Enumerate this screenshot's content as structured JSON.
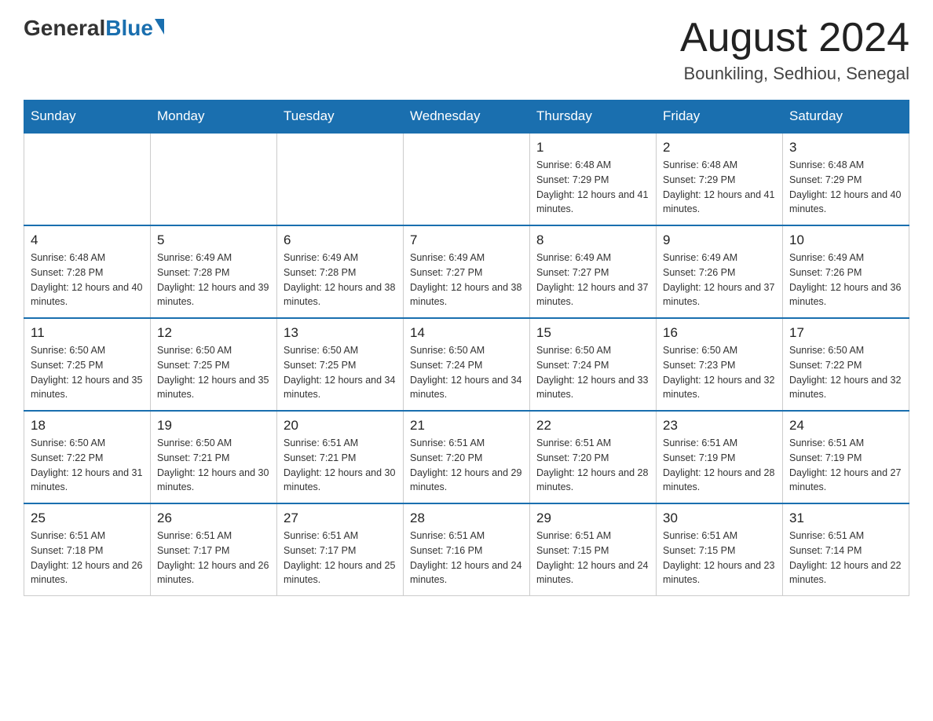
{
  "header": {
    "logo": {
      "general": "General",
      "blue": "Blue"
    },
    "title": "August 2024",
    "location": "Bounkiling, Sedhiou, Senegal"
  },
  "calendar": {
    "days_of_week": [
      "Sunday",
      "Monday",
      "Tuesday",
      "Wednesday",
      "Thursday",
      "Friday",
      "Saturday"
    ],
    "weeks": [
      [
        {
          "day": "",
          "info": ""
        },
        {
          "day": "",
          "info": ""
        },
        {
          "day": "",
          "info": ""
        },
        {
          "day": "",
          "info": ""
        },
        {
          "day": "1",
          "info": "Sunrise: 6:48 AM\nSunset: 7:29 PM\nDaylight: 12 hours and 41 minutes."
        },
        {
          "day": "2",
          "info": "Sunrise: 6:48 AM\nSunset: 7:29 PM\nDaylight: 12 hours and 41 minutes."
        },
        {
          "day": "3",
          "info": "Sunrise: 6:48 AM\nSunset: 7:29 PM\nDaylight: 12 hours and 40 minutes."
        }
      ],
      [
        {
          "day": "4",
          "info": "Sunrise: 6:48 AM\nSunset: 7:28 PM\nDaylight: 12 hours and 40 minutes."
        },
        {
          "day": "5",
          "info": "Sunrise: 6:49 AM\nSunset: 7:28 PM\nDaylight: 12 hours and 39 minutes."
        },
        {
          "day": "6",
          "info": "Sunrise: 6:49 AM\nSunset: 7:28 PM\nDaylight: 12 hours and 38 minutes."
        },
        {
          "day": "7",
          "info": "Sunrise: 6:49 AM\nSunset: 7:27 PM\nDaylight: 12 hours and 38 minutes."
        },
        {
          "day": "8",
          "info": "Sunrise: 6:49 AM\nSunset: 7:27 PM\nDaylight: 12 hours and 37 minutes."
        },
        {
          "day": "9",
          "info": "Sunrise: 6:49 AM\nSunset: 7:26 PM\nDaylight: 12 hours and 37 minutes."
        },
        {
          "day": "10",
          "info": "Sunrise: 6:49 AM\nSunset: 7:26 PM\nDaylight: 12 hours and 36 minutes."
        }
      ],
      [
        {
          "day": "11",
          "info": "Sunrise: 6:50 AM\nSunset: 7:25 PM\nDaylight: 12 hours and 35 minutes."
        },
        {
          "day": "12",
          "info": "Sunrise: 6:50 AM\nSunset: 7:25 PM\nDaylight: 12 hours and 35 minutes."
        },
        {
          "day": "13",
          "info": "Sunrise: 6:50 AM\nSunset: 7:25 PM\nDaylight: 12 hours and 34 minutes."
        },
        {
          "day": "14",
          "info": "Sunrise: 6:50 AM\nSunset: 7:24 PM\nDaylight: 12 hours and 34 minutes."
        },
        {
          "day": "15",
          "info": "Sunrise: 6:50 AM\nSunset: 7:24 PM\nDaylight: 12 hours and 33 minutes."
        },
        {
          "day": "16",
          "info": "Sunrise: 6:50 AM\nSunset: 7:23 PM\nDaylight: 12 hours and 32 minutes."
        },
        {
          "day": "17",
          "info": "Sunrise: 6:50 AM\nSunset: 7:22 PM\nDaylight: 12 hours and 32 minutes."
        }
      ],
      [
        {
          "day": "18",
          "info": "Sunrise: 6:50 AM\nSunset: 7:22 PM\nDaylight: 12 hours and 31 minutes."
        },
        {
          "day": "19",
          "info": "Sunrise: 6:50 AM\nSunset: 7:21 PM\nDaylight: 12 hours and 30 minutes."
        },
        {
          "day": "20",
          "info": "Sunrise: 6:51 AM\nSunset: 7:21 PM\nDaylight: 12 hours and 30 minutes."
        },
        {
          "day": "21",
          "info": "Sunrise: 6:51 AM\nSunset: 7:20 PM\nDaylight: 12 hours and 29 minutes."
        },
        {
          "day": "22",
          "info": "Sunrise: 6:51 AM\nSunset: 7:20 PM\nDaylight: 12 hours and 28 minutes."
        },
        {
          "day": "23",
          "info": "Sunrise: 6:51 AM\nSunset: 7:19 PM\nDaylight: 12 hours and 28 minutes."
        },
        {
          "day": "24",
          "info": "Sunrise: 6:51 AM\nSunset: 7:19 PM\nDaylight: 12 hours and 27 minutes."
        }
      ],
      [
        {
          "day": "25",
          "info": "Sunrise: 6:51 AM\nSunset: 7:18 PM\nDaylight: 12 hours and 26 minutes."
        },
        {
          "day": "26",
          "info": "Sunrise: 6:51 AM\nSunset: 7:17 PM\nDaylight: 12 hours and 26 minutes."
        },
        {
          "day": "27",
          "info": "Sunrise: 6:51 AM\nSunset: 7:17 PM\nDaylight: 12 hours and 25 minutes."
        },
        {
          "day": "28",
          "info": "Sunrise: 6:51 AM\nSunset: 7:16 PM\nDaylight: 12 hours and 24 minutes."
        },
        {
          "day": "29",
          "info": "Sunrise: 6:51 AM\nSunset: 7:15 PM\nDaylight: 12 hours and 24 minutes."
        },
        {
          "day": "30",
          "info": "Sunrise: 6:51 AM\nSunset: 7:15 PM\nDaylight: 12 hours and 23 minutes."
        },
        {
          "day": "31",
          "info": "Sunrise: 6:51 AM\nSunset: 7:14 PM\nDaylight: 12 hours and 22 minutes."
        }
      ]
    ]
  }
}
